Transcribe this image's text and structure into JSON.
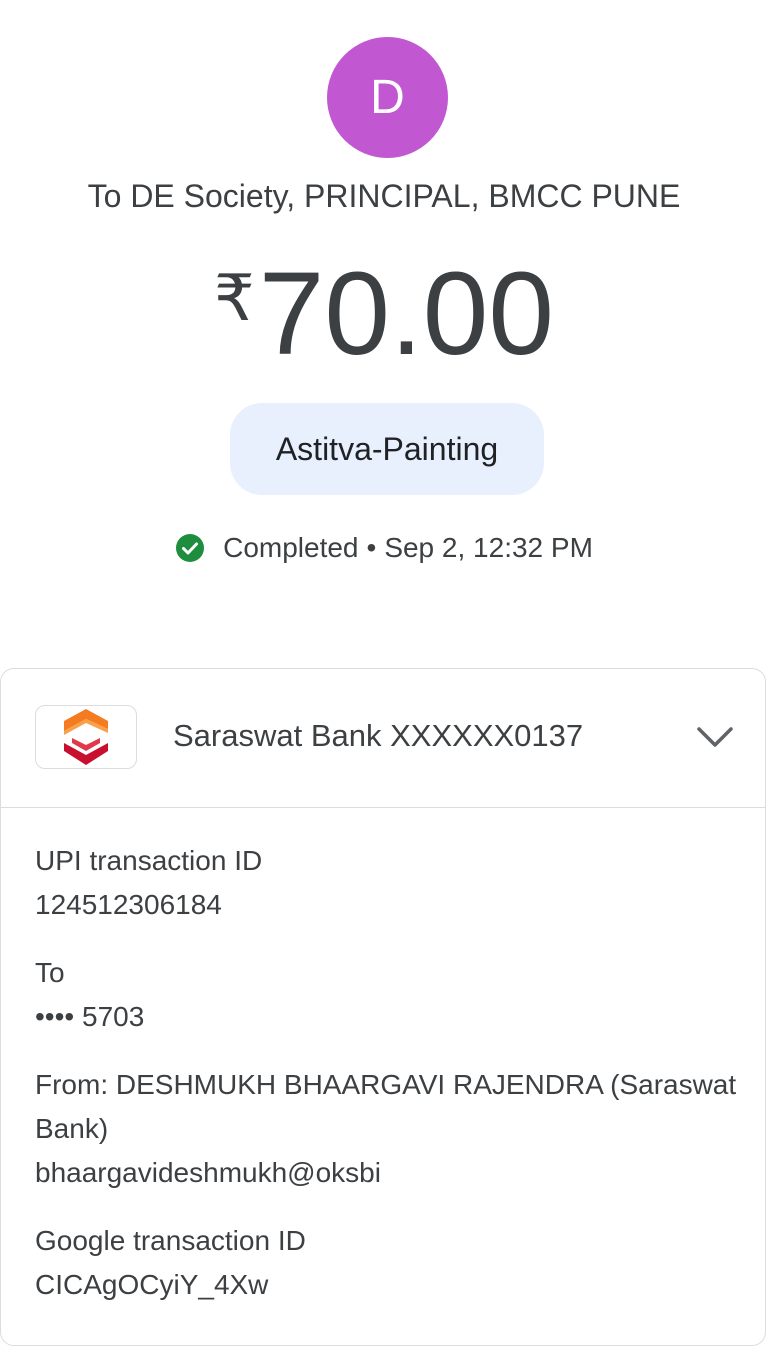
{
  "header": {
    "avatar_letter": "D",
    "avatar_color": "#c158d2",
    "recipient": "To DE Society, PRINCIPAL, BMCC PUNE"
  },
  "amount": {
    "currency": "₹",
    "value": "70.00"
  },
  "note": "Astitva-Painting",
  "status": {
    "icon": "check-circle-icon",
    "label": "Completed",
    "separator": "•",
    "timestamp": "Sep 2, 12:32 PM",
    "color": "#1e8e3e"
  },
  "account": {
    "bank_name": "Saraswat Bank XXXXXX0137",
    "icon": "chevron-down-icon"
  },
  "details": {
    "upi_label": "UPI transaction ID",
    "upi_value": "124512306184",
    "to_label": "To",
    "to_value": "•••• 5703",
    "from_label": "From: DESHMUKH BHAARGAVI RAJENDRA (Saraswat Bank)",
    "from_value": "bhaargavideshmukh@oksbi",
    "google_label": "Google transaction ID",
    "google_value": "CICAgOCyiY_4Xw"
  }
}
